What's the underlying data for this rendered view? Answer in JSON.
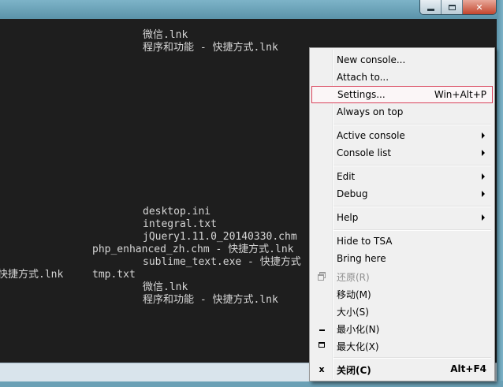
{
  "console": {
    "lines": [
      "微信.lnk",
      "程序和功能 - 快捷方式.lnk",
      "desktop.ini",
      "integral.txt",
      "jQuery1.11.0_20140330.chm",
      "php_enhanced_zh.chm - 快捷方式.lnk",
      "sublime_text.exe - 快捷方式",
      "快捷方式.lnk",
      "tmp.txt",
      "微信.lnk",
      "程序和功能 - 快捷方式.lnk"
    ]
  },
  "menu": {
    "new_console": "New console...",
    "attach_to": "Attach to...",
    "settings": "Settings...",
    "settings_shortcut": "Win+Alt+P",
    "always_on_top": "Always on top",
    "active_console": "Active console",
    "console_list": "Console list",
    "edit": "Edit",
    "debug": "Debug",
    "help": "Help",
    "hide_to_tsa": "Hide to TSA",
    "bring_here": "Bring here",
    "restore": "还原(R)",
    "move": "移动(M)",
    "size": "大小(S)",
    "minimize": "最小化(N)",
    "maximize": "最大化(X)",
    "close": "关闭(C)",
    "close_shortcut": "Alt+F4"
  },
  "colors": {
    "console_bg": "#1e1e1e",
    "console_text": "#d6d6d6",
    "menu_bg": "#f0f0f0",
    "highlight_border": "#d9435b",
    "close_button": "#c2452c"
  }
}
